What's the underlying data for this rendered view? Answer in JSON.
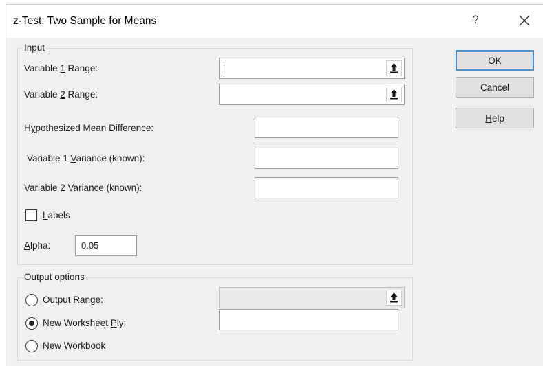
{
  "dialog": {
    "title": "z-Test: Two Sample for Means",
    "help_glyph": "?"
  },
  "input_group": {
    "label": "Input",
    "var1_range": {
      "pre": "Variable ",
      "key": "1",
      "post": " Range:",
      "value": ""
    },
    "var2_range": {
      "pre": "Variable ",
      "key": "2",
      "post": " Range:",
      "value": ""
    },
    "hyp_mean_diff": {
      "pre": "H",
      "key": "y",
      "post": "pothesized Mean Difference:",
      "value": ""
    },
    "var1_variance": {
      "pre": "Variable 1 ",
      "key": "V",
      "post": "ariance (known):",
      "value": ""
    },
    "var2_variance": {
      "pre": "Variable 2 Va",
      "key": "r",
      "post": "iance (known):",
      "value": ""
    },
    "labels_checkbox": {
      "pre": "",
      "key": "L",
      "post": "abels",
      "checked": false
    },
    "alpha": {
      "pre": "",
      "key": "A",
      "post": "lpha:",
      "value": "0.05"
    }
  },
  "output_group": {
    "label": "Output options",
    "output_range": {
      "pre": "",
      "key": "O",
      "post": "utput Range:",
      "selected": false,
      "value": ""
    },
    "new_worksheet": {
      "pre": "New Worksheet ",
      "key": "P",
      "post": "ly:",
      "selected": true,
      "value": ""
    },
    "new_workbook": {
      "pre": "New ",
      "key": "W",
      "post": "orkbook",
      "selected": false
    }
  },
  "buttons": {
    "ok": "OK",
    "cancel": "Cancel",
    "help": {
      "pre": "",
      "key": "H",
      "post": "elp"
    }
  },
  "icons": {
    "collapse": "collapse-range-icon",
    "close": "close-icon"
  }
}
